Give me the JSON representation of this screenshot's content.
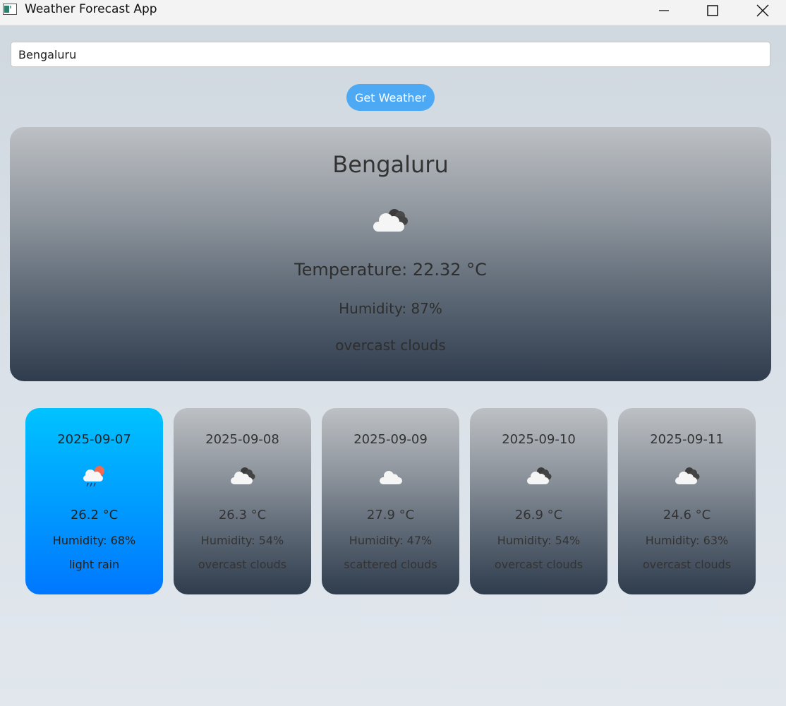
{
  "window": {
    "title": "Weather Forecast App",
    "controls": [
      "minimize",
      "maximize",
      "close"
    ]
  },
  "search": {
    "value": "Bengaluru",
    "button_label": "Get Weather",
    "button_color": "#4ea9f5"
  },
  "current": {
    "city": "Bengaluru",
    "icon": "overcast-clouds-icon",
    "temperature": "Temperature: 22.32 °C",
    "humidity": "Humidity: 87%",
    "description": "overcast clouds"
  },
  "forecast": [
    {
      "date": "2025-09-07",
      "icon": "light-rain-icon",
      "temp": "26.2 °C",
      "humidity": "Humidity: 68%",
      "description": "light rain",
      "selected": true
    },
    {
      "date": "2025-09-08",
      "icon": "overcast-clouds-icon",
      "temp": "26.3 °C",
      "humidity": "Humidity: 54%",
      "description": "overcast clouds",
      "selected": false
    },
    {
      "date": "2025-09-09",
      "icon": "scattered-clouds-icon",
      "temp": "27.9 °C",
      "humidity": "Humidity: 47%",
      "description": "scattered clouds",
      "selected": false
    },
    {
      "date": "2025-09-10",
      "icon": "overcast-clouds-icon",
      "temp": "26.9 °C",
      "humidity": "Humidity: 54%",
      "description": "overcast clouds",
      "selected": false
    },
    {
      "date": "2025-09-11",
      "icon": "overcast-clouds-icon",
      "temp": "24.6 °C",
      "humidity": "Humidity: 63%",
      "description": "overcast clouds",
      "selected": false
    }
  ],
  "colors": {
    "selected_card_top": "#00c3ff",
    "selected_card_bottom": "#0077ff",
    "card_top": "#bdc0c4",
    "card_bottom": "#2f3c4d"
  }
}
